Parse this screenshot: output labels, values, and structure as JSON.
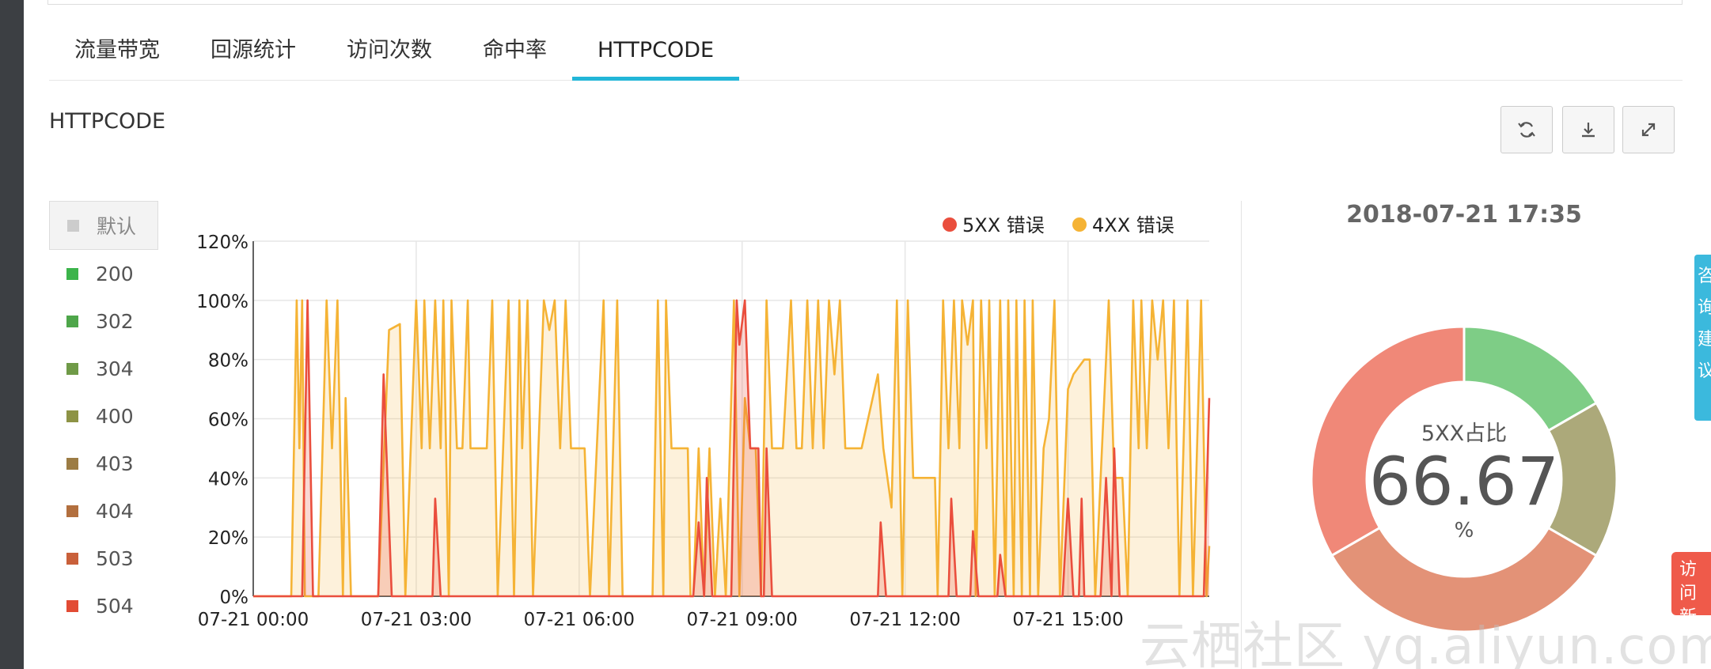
{
  "tabs": [
    {
      "label": "流量带宽"
    },
    {
      "label": "回源统计"
    },
    {
      "label": "访问次数"
    },
    {
      "label": "命中率"
    },
    {
      "label": "HTTPCODE"
    }
  ],
  "section_title": "HTTPCODE",
  "toolbar": {
    "icons": [
      "refresh-icon",
      "download-icon",
      "fullscreen-icon"
    ]
  },
  "status_legend": {
    "default_label": "默认",
    "items": [
      {
        "label": "200",
        "color": "#3cb44b"
      },
      {
        "label": "302",
        "color": "#4ea64a"
      },
      {
        "label": "304",
        "color": "#6f9a47"
      },
      {
        "label": "400",
        "color": "#8d9345"
      },
      {
        "label": "403",
        "color": "#9c7c44"
      },
      {
        "label": "404",
        "color": "#b26f3e"
      },
      {
        "label": "503",
        "color": "#c9603a"
      },
      {
        "label": "504",
        "color": "#e24b34"
      }
    ]
  },
  "chart_data": [
    {
      "type": "area",
      "x_tick_labels": [
        "07-21 00:00",
        "07-21 03:00",
        "07-21 06:00",
        "07-21 09:00",
        "07-21 12:00",
        "07-21 15:00"
      ],
      "x_range_hours": [
        0,
        17.6
      ],
      "y_tick_labels": [
        "0%",
        "20%",
        "40%",
        "60%",
        "80%",
        "100%",
        "120%"
      ],
      "ylim": [
        0,
        120
      ],
      "grid": true,
      "legend_position": "top-right",
      "series": [
        {
          "name": "5XX 错误",
          "color": "#ea4e3d",
          "points": [
            [
              0,
              0
            ],
            [
              0.9,
              0
            ],
            [
              1.0,
              100
            ],
            [
              1.1,
              0
            ],
            [
              2.3,
              0
            ],
            [
              2.4,
              75
            ],
            [
              2.55,
              0
            ],
            [
              3.3,
              0
            ],
            [
              3.35,
              33
            ],
            [
              3.45,
              0
            ],
            [
              8.1,
              0
            ],
            [
              8.2,
              25
            ],
            [
              8.3,
              0
            ],
            [
              8.3,
              0
            ],
            [
              8.35,
              40
            ],
            [
              8.45,
              0
            ],
            [
              8.8,
              0
            ],
            [
              8.9,
              100
            ],
            [
              8.95,
              85
            ],
            [
              9.05,
              100
            ],
            [
              9.15,
              50
            ],
            [
              9.3,
              50
            ],
            [
              9.35,
              0
            ],
            [
              9.4,
              0
            ],
            [
              9.45,
              50
            ],
            [
              9.55,
              0
            ],
            [
              11.5,
              0
            ],
            [
              11.55,
              25
            ],
            [
              11.65,
              0
            ],
            [
              12.8,
              0
            ],
            [
              12.85,
              33
            ],
            [
              12.95,
              0
            ],
            [
              13.2,
              0
            ],
            [
              13.25,
              22
            ],
            [
              13.35,
              0
            ],
            [
              13.7,
              0
            ],
            [
              13.75,
              14
            ],
            [
              13.85,
              0
            ],
            [
              14.9,
              0
            ],
            [
              15.0,
              33
            ],
            [
              15.1,
              0
            ],
            [
              15.2,
              0
            ],
            [
              15.25,
              33
            ],
            [
              15.3,
              0
            ],
            [
              15.6,
              0
            ],
            [
              15.7,
              40
            ],
            [
              15.8,
              0
            ],
            [
              15.85,
              50
            ],
            [
              15.95,
              0
            ],
            [
              17.5,
              0
            ],
            [
              17.6,
              67
            ]
          ]
        },
        {
          "name": "4XX 错误",
          "color": "#f5b335",
          "points": [
            [
              0,
              0
            ],
            [
              0.7,
              0
            ],
            [
              0.8,
              100
            ],
            [
              0.85,
              50
            ],
            [
              0.9,
              100
            ],
            [
              0.95,
              0
            ],
            [
              1.2,
              0
            ],
            [
              1.35,
              100
            ],
            [
              1.45,
              50
            ],
            [
              1.55,
              100
            ],
            [
              1.65,
              0
            ],
            [
              1.7,
              67
            ],
            [
              1.8,
              0
            ],
            [
              2.3,
              0
            ],
            [
              2.5,
              90
            ],
            [
              2.7,
              92
            ],
            [
              2.8,
              0
            ],
            [
              2.9,
              50
            ],
            [
              3.0,
              100
            ],
            [
              3.1,
              50
            ],
            [
              3.15,
              100
            ],
            [
              3.25,
              50
            ],
            [
              3.35,
              100
            ],
            [
              3.45,
              50
            ],
            [
              3.5,
              100
            ],
            [
              3.6,
              0
            ],
            [
              3.65,
              100
            ],
            [
              3.75,
              50
            ],
            [
              3.85,
              50
            ],
            [
              3.95,
              100
            ],
            [
              4.0,
              50
            ],
            [
              4.3,
              50
            ],
            [
              4.4,
              100
            ],
            [
              4.5,
              0
            ],
            [
              4.7,
              100
            ],
            [
              4.8,
              0
            ],
            [
              4.9,
              100
            ],
            [
              4.95,
              50
            ],
            [
              5.05,
              100
            ],
            [
              5.15,
              0
            ],
            [
              5.35,
              100
            ],
            [
              5.45,
              90
            ],
            [
              5.55,
              100
            ],
            [
              5.65,
              50
            ],
            [
              5.75,
              100
            ],
            [
              5.85,
              50
            ],
            [
              6.1,
              50
            ],
            [
              6.2,
              0
            ],
            [
              6.45,
              100
            ],
            [
              6.55,
              0
            ],
            [
              6.7,
              100
            ],
            [
              6.8,
              0
            ],
            [
              7.35,
              0
            ],
            [
              7.45,
              100
            ],
            [
              7.55,
              0
            ],
            [
              7.6,
              100
            ],
            [
              7.7,
              50
            ],
            [
              8.0,
              50
            ],
            [
              8.05,
              0
            ],
            [
              8.1,
              0
            ],
            [
              8.2,
              50
            ],
            [
              8.3,
              0
            ],
            [
              8.4,
              50
            ],
            [
              8.5,
              0
            ],
            [
              8.6,
              33
            ],
            [
              8.7,
              0
            ],
            [
              8.85,
              100
            ],
            [
              8.95,
              0
            ],
            [
              9.05,
              67
            ],
            [
              9.15,
              50
            ],
            [
              9.25,
              50
            ],
            [
              9.35,
              0
            ],
            [
              9.45,
              100
            ],
            [
              9.55,
              50
            ],
            [
              9.75,
              50
            ],
            [
              9.9,
              100
            ],
            [
              10.0,
              50
            ],
            [
              10.1,
              50
            ],
            [
              10.2,
              100
            ],
            [
              10.3,
              50
            ],
            [
              10.4,
              100
            ],
            [
              10.5,
              50
            ],
            [
              10.6,
              100
            ],
            [
              10.7,
              75
            ],
            [
              10.8,
              100
            ],
            [
              10.9,
              50
            ],
            [
              11.2,
              50
            ],
            [
              11.5,
              75
            ],
            [
              11.6,
              50
            ],
            [
              11.75,
              30
            ],
            [
              11.85,
              100
            ],
            [
              11.95,
              0
            ],
            [
              12.05,
              100
            ],
            [
              12.15,
              40
            ],
            [
              12.35,
              40
            ],
            [
              12.55,
              40
            ],
            [
              12.6,
              0
            ],
            [
              12.7,
              100
            ],
            [
              12.8,
              50
            ],
            [
              12.9,
              100
            ],
            [
              13.0,
              50
            ],
            [
              13.05,
              100
            ],
            [
              13.15,
              85
            ],
            [
              13.25,
              100
            ],
            [
              13.3,
              0
            ],
            [
              13.4,
              100
            ],
            [
              13.5,
              50
            ],
            [
              13.55,
              100
            ],
            [
              13.65,
              0
            ],
            [
              13.75,
              100
            ],
            [
              13.85,
              0
            ],
            [
              13.9,
              100
            ],
            [
              14.0,
              0
            ],
            [
              14.05,
              100
            ],
            [
              14.15,
              0
            ],
            [
              14.2,
              100
            ],
            [
              14.3,
              0
            ],
            [
              14.35,
              100
            ],
            [
              14.45,
              0
            ],
            [
              14.55,
              50
            ],
            [
              14.65,
              60
            ],
            [
              14.75,
              100
            ],
            [
              14.85,
              0
            ],
            [
              15.0,
              70
            ],
            [
              15.1,
              75
            ],
            [
              15.3,
              80
            ],
            [
              15.4,
              80
            ],
            [
              15.5,
              0
            ],
            [
              15.75,
              100
            ],
            [
              15.85,
              40
            ],
            [
              16.0,
              40
            ],
            [
              16.1,
              0
            ],
            [
              16.2,
              100
            ],
            [
              16.3,
              50
            ],
            [
              16.35,
              100
            ],
            [
              16.45,
              50
            ],
            [
              16.55,
              100
            ],
            [
              16.65,
              80
            ],
            [
              16.75,
              100
            ],
            [
              16.85,
              50
            ],
            [
              16.95,
              100
            ],
            [
              17.05,
              0
            ],
            [
              17.2,
              100
            ],
            [
              17.3,
              0
            ],
            [
              17.45,
              100
            ],
            [
              17.55,
              0
            ],
            [
              17.6,
              17
            ]
          ]
        }
      ]
    },
    {
      "type": "pie",
      "title": "2018-07-21 17:35",
      "center_label": "5XX占比",
      "center_value": "66.67",
      "center_unit": "%",
      "slices": [
        {
          "color": "#7ecd86",
          "percent": 16.67
        },
        {
          "color": "#aca97a",
          "percent": 16.67
        },
        {
          "color": "#e39277",
          "percent": 33.33
        },
        {
          "color": "#f08878",
          "percent": 33.33
        }
      ]
    }
  ],
  "side_float_text": "咨询 建议",
  "side_new_text": "访问 新版",
  "watermark": "云栖社区 yq.aliyun.com"
}
